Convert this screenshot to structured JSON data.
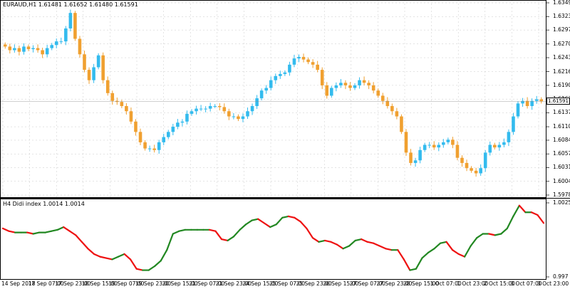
{
  "main_chart": {
    "symbol_label": "EURAUD,H1  1.61481 1.61652 1.61480 1.61591",
    "current_price": "1.61591",
    "price_ticks": [
      "1.63495",
      "1.63230",
      "1.62970",
      "1.62700",
      "1.62435",
      "1.62165",
      "1.61900",
      "1.61635",
      "1.61370",
      "1.61100",
      "1.60840",
      "1.60575",
      "1.60310",
      "1.60045",
      "1.59780"
    ],
    "colors": {
      "up": "#33bbee",
      "down": "#f0a030",
      "grid": "#c8c8c8"
    }
  },
  "indicator": {
    "label": "H4 Didi index 1.0014 1.0014",
    "ticks": [
      "1.0025",
      "0.997"
    ],
    "colors": {
      "up": "#228822",
      "down": "#ee1111"
    }
  },
  "time_axis": {
    "labels": [
      "14 Sep 2018",
      "17 Sep 07:00",
      "17 Sep 23:00",
      "18 Sep 15:00",
      "19 Sep 07:00",
      "19 Sep 23:00",
      "20 Sep 15:00",
      "21 Sep 07:00",
      "21 Sep 23:00",
      "24 Sep 15:00",
      "25 Sep 07:00",
      "25 Sep 23:00",
      "26 Sep 15:00",
      "27 Sep 07:00",
      "27 Sep 23:00",
      "28 Sep 15:00",
      "1 Oct 07:00",
      "1 Oct 23:00",
      "2 Oct 15:00",
      "3 Oct 07:00",
      "3 Oct 23:00"
    ]
  },
  "chart_data": [
    {
      "type": "line",
      "title": "EURAUD,H1",
      "series": [
        {
          "name": "EURAUD,H1",
          "values": [
            1.6265,
            1.6258,
            1.6262,
            1.6255,
            1.6265,
            1.626,
            1.6262,
            1.6258,
            1.625,
            1.6262,
            1.6268,
            1.6275,
            1.6275,
            1.63,
            1.633,
            1.628,
            1.625,
            1.622,
            1.62,
            1.6225,
            1.6248,
            1.62,
            1.6175,
            1.616,
            1.6158,
            1.615,
            1.614,
            1.612,
            1.61,
            1.608,
            1.6068,
            1.6068,
            1.6065,
            1.608,
            1.609,
            1.61,
            1.611,
            1.6118,
            1.612,
            1.6135,
            1.614,
            1.6145,
            1.6145,
            1.6145,
            1.615,
            1.615,
            1.6148,
            1.614,
            1.613,
            1.613,
            1.6125,
            1.613,
            1.614,
            1.615,
            1.6165,
            1.618,
            1.6185,
            1.62,
            1.6208,
            1.6212,
            1.6215,
            1.623,
            1.6242,
            1.6245,
            1.624,
            1.6235,
            1.623,
            1.622,
            1.619,
            1.617,
            1.6185,
            1.619,
            1.6195,
            1.619,
            1.6185,
            1.619,
            1.62,
            1.6195,
            1.619,
            1.618,
            1.617,
            1.616,
            1.615,
            1.614,
            1.613,
            1.61,
            1.606,
            1.604,
            1.6045,
            1.6065,
            1.6075,
            1.6075,
            1.607,
            1.6075,
            1.608,
            1.6085,
            1.6075,
            1.605,
            1.604,
            1.603,
            1.6025,
            1.602,
            1.603,
            1.606,
            1.6075,
            1.607,
            1.6075,
            1.608,
            1.61,
            1.613,
            1.6155,
            1.616,
            1.615,
            1.616,
            1.6163,
            1.6159
          ]
        }
      ]
    },
    {
      "type": "line",
      "title": "H4 Didi index",
      "ylim": [
        0.997,
        1.0025
      ],
      "series": [
        {
          "name": "H4 Didi index",
          "values": [
            1.0006,
            1.0004,
            1.0003,
            1.0003,
            1.0003,
            1.0002,
            1.0003,
            1.0003,
            1.0004,
            1.0005,
            1.0007,
            1.0004,
            1.0001,
            0.9996,
            0.9991,
            0.9987,
            0.9985,
            0.9984,
            0.9983,
            0.9985,
            0.9987,
            0.9983,
            0.9976,
            0.9975,
            0.9975,
            0.9978,
            0.9982,
            0.999,
            1.0002,
            1.0004,
            1.0005,
            1.0005,
            1.0005,
            1.0005,
            1.0005,
            1.0004,
            0.9998,
            0.9997,
            1.0,
            1.0005,
            1.0009,
            1.0012,
            1.0013,
            1.001,
            1.0007,
            1.0009,
            1.0014,
            1.0015,
            1.0014,
            1.0011,
            1.0006,
            0.9999,
            0.9996,
            0.9997,
            0.9996,
            0.9994,
            0.9991,
            0.9993,
            0.9997,
            0.9998,
            0.9996,
            0.9995,
            0.9993,
            0.9991,
            0.999,
            0.999,
            0.9983,
            0.9975,
            0.9976,
            0.9984,
            0.9988,
            0.9991,
            0.9995,
            0.9996,
            0.999,
            0.9987,
            0.9985,
            0.9993,
            0.9999,
            1.0002,
            1.0002,
            1.0001,
            1.0002,
            1.0006,
            1.0015,
            1.0023,
            1.0018,
            1.0018,
            1.0016,
            1.001
          ]
        }
      ]
    }
  ]
}
